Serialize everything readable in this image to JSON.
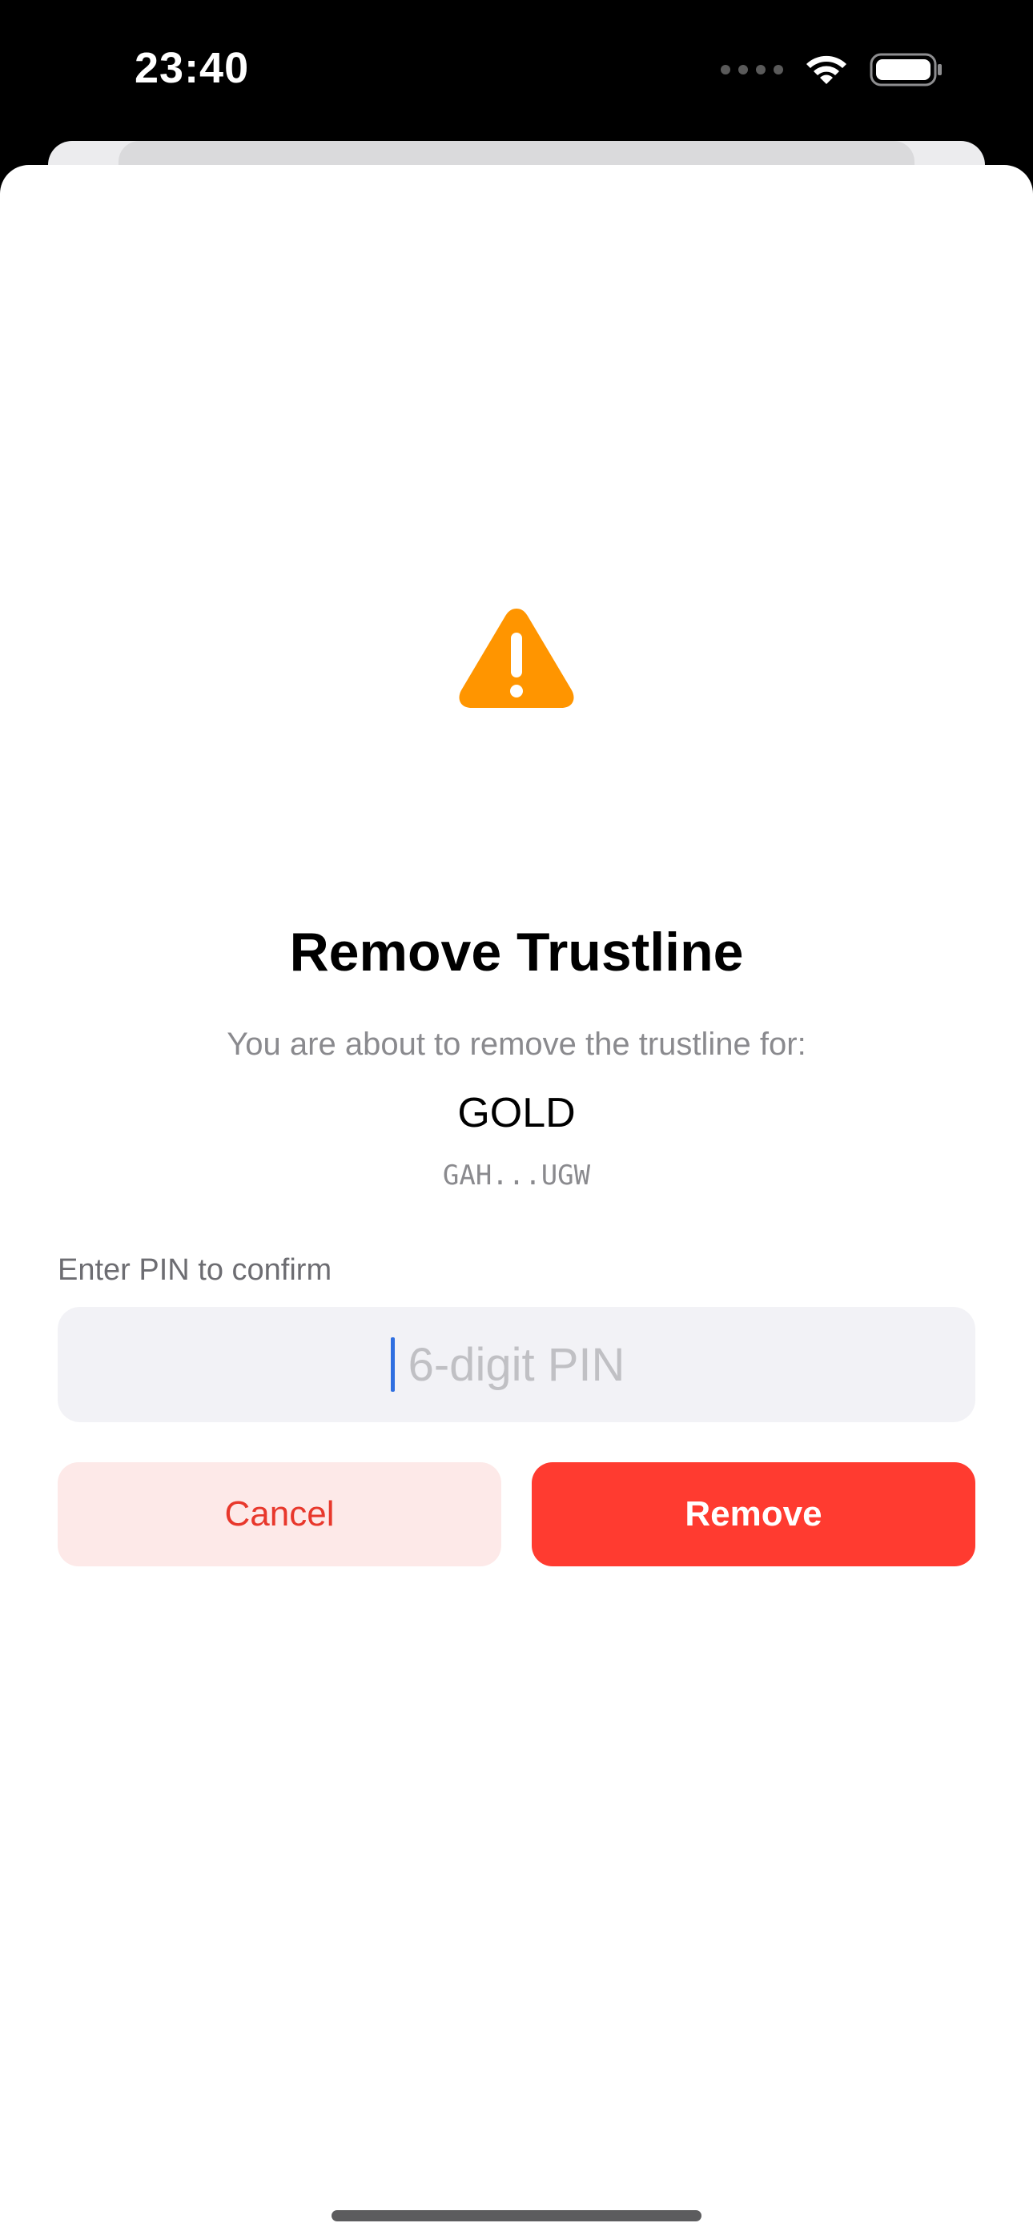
{
  "status_bar": {
    "time": "23:40",
    "signal_icon": "cellular-dots-icon",
    "wifi_icon": "wifi-icon",
    "battery_icon": "battery-icon"
  },
  "dialog": {
    "icon": "warning-triangle-icon",
    "icon_color": "#ff9500",
    "title": "Remove Trustline",
    "subtitle": "You are about to remove the trustline for:",
    "asset_code": "GOLD",
    "asset_issuer": "GAH...UGW",
    "pin_label": "Enter PIN to confirm",
    "pin_placeholder": "6-digit PIN",
    "pin_value": "",
    "cancel_label": "Cancel",
    "remove_label": "Remove",
    "accent_destructive": "#ff3b30"
  }
}
